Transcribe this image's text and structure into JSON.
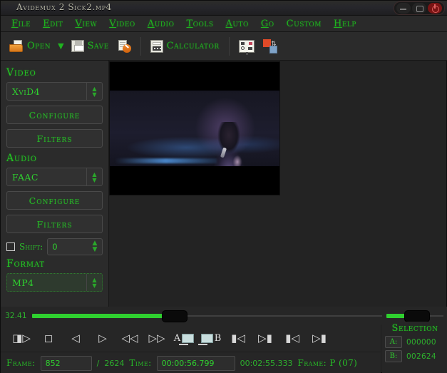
{
  "window": {
    "title": "Avidemux 2 Sick2.mp4",
    "controls": [
      {
        "name": "minimize",
        "glyph": "—"
      },
      {
        "name": "maximize",
        "glyph": "□"
      },
      {
        "name": "close",
        "glyph": "✕"
      }
    ]
  },
  "menubar": {
    "items": [
      {
        "label": "File",
        "mnemonic": "F"
      },
      {
        "label": "Edit",
        "mnemonic": "E"
      },
      {
        "label": "View",
        "mnemonic": "V"
      },
      {
        "label": "Video",
        "mnemonic": "V"
      },
      {
        "label": "Audio",
        "mnemonic": "A"
      },
      {
        "label": "Tools",
        "mnemonic": "T"
      },
      {
        "label": "Auto",
        "mnemonic": "A"
      },
      {
        "label": "Go",
        "mnemonic": "G"
      },
      {
        "label": "Custom",
        "mnemonic": "C"
      },
      {
        "label": "Help",
        "mnemonic": "H"
      }
    ]
  },
  "toolbar": {
    "open_label": "Open",
    "open_dropdown_glyph": "▼",
    "save_label": "Save",
    "save_as_icon": "save-with-options-icon",
    "calculator_label": "Calculator",
    "display_icon": "display-settings-icon",
    "swap_icon": "swap-colors-icon"
  },
  "video_section": {
    "title": "Video",
    "codec_value": "XviD4",
    "configure_label": "Configure",
    "filters_label": "Filters"
  },
  "audio_section": {
    "title": "Audio",
    "codec_value": "FAAC",
    "configure_label": "Configure",
    "filters_label": "Filters",
    "shift_label": "Shift:",
    "shift_value": "0",
    "shift_checked": false
  },
  "format_section": {
    "title": "Format",
    "format_value": "MP4"
  },
  "preview": {
    "description": "video-frame-singer-on-stage"
  },
  "slider": {
    "position_label": "32.41",
    "main_progress_percent": 39,
    "mini_progress_percent": 42
  },
  "transport": {
    "buttons": [
      {
        "name": "play-button",
        "glyph": "▶"
      },
      {
        "name": "stop-button",
        "glyph": "■"
      },
      {
        "name": "previous-frame-button",
        "glyph": "◀"
      },
      {
        "name": "next-frame-button",
        "glyph": "▷"
      },
      {
        "name": "rewind-button",
        "glyph": "◀◀"
      },
      {
        "name": "forward-button",
        "glyph": "▷▷"
      },
      {
        "name": "marker-a-button",
        "glyph": "A"
      },
      {
        "name": "marker-b-button",
        "glyph": "B"
      },
      {
        "name": "go-to-start-button",
        "glyph": "⏮"
      },
      {
        "name": "go-to-end-button",
        "glyph": "⏭"
      },
      {
        "name": "previous-keyframe-button",
        "glyph": "⏴"
      },
      {
        "name": "next-keyframe-button",
        "glyph": "⏵"
      }
    ],
    "marker_a_label": "A",
    "marker_b_label": "B"
  },
  "selection": {
    "title": "Selection",
    "a_label": "A:",
    "a_value": "000000",
    "b_label": "B:",
    "b_value": "002624"
  },
  "statusbar": {
    "frame_label": "Frame:",
    "frame_value": "852",
    "frame_separator": "/",
    "frame_total": "2624",
    "time_label": "Time:",
    "time_value": "00:00:56.799",
    "total_time": "00:02:55.333",
    "frame_type": "Frame: P (07)"
  },
  "colors": {
    "accent_green": "#2fcf2f",
    "bg_dark": "#2b2b2b",
    "bg_panel": "#262626",
    "title_text": "#b9b9a8",
    "orange": "#e04a28",
    "blue": "#7fa3c8"
  }
}
